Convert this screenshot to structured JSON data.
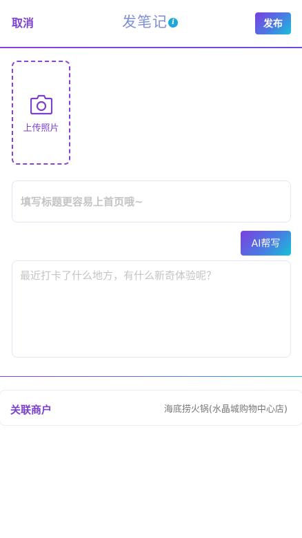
{
  "header": {
    "cancel_label": "取消",
    "title": "发笔记",
    "info_icon": "info-icon",
    "publish_label": "发布"
  },
  "upload": {
    "icon": "camera-icon",
    "label": "上传照片"
  },
  "form": {
    "title_placeholder": "填写标题更容易上首页哦~",
    "title_value": "",
    "ai_button_label": "AI帮写",
    "content_placeholder": "最近打卡了什么地方，有什么新奇体验呢？",
    "content_value": ""
  },
  "merchant": {
    "label": "关联商户",
    "value": "海底捞火锅(水晶城购物中心店)"
  },
  "colors": {
    "accent": "#7b3fd0",
    "gradient_start": "#7b3ee0",
    "gradient_end": "#16c1d8",
    "info": "#1fa7d9"
  }
}
